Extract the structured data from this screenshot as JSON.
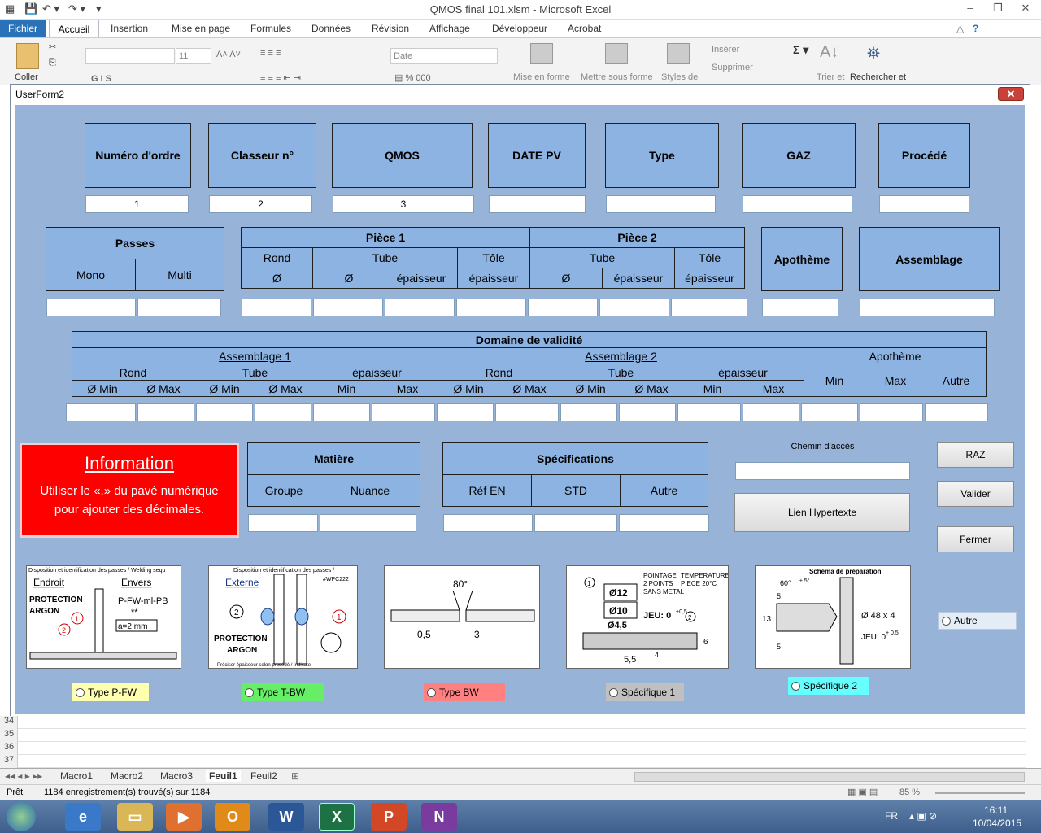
{
  "window": {
    "title": "QMOS final 101.xlsm  -  Microsoft Excel"
  },
  "ribbon": {
    "tabs": [
      "Fichier",
      "Accueil",
      "Insertion",
      "Mise en page",
      "Formules",
      "Données",
      "Révision",
      "Affichage",
      "Développeur",
      "Acrobat"
    ],
    "coller": "Coller",
    "font_size": "11",
    "number_format": "Date",
    "inserer": "Insérer",
    "supprimer": "Supprimer",
    "mise_en_forme": "Mise en forme",
    "mettre_sous_forme": "Mettre sous forme",
    "styles_de": "Styles de",
    "trier": "Trier et",
    "rechercher": "Rechercher et"
  },
  "form": {
    "title": "UserForm2",
    "close": "✕",
    "top_headers": [
      "Numéro d'ordre",
      "Classeur n°",
      "QMOS",
      "DATE PV",
      "Type",
      "GAZ",
      "Procédé"
    ],
    "top_values": [
      "1",
      "2",
      "3",
      "",
      "",
      "",
      ""
    ],
    "passes": {
      "title": "Passes",
      "mono": "Mono",
      "multi": "Multi"
    },
    "piece1": {
      "title": "Pièce 1",
      "rond": "Rond",
      "tube": "Tube",
      "tole": "Tôle",
      "phi": "Ø",
      "epaisseur": "épaisseur"
    },
    "piece2": {
      "title": "Pièce 2",
      "tube": "Tube",
      "tole": "Tôle",
      "phi": "Ø",
      "epaisseur": "épaisseur"
    },
    "apotheme": "Apothème",
    "assemblage": "Assemblage",
    "domaine": {
      "title": "Domaine de validité",
      "assemblage1": "Assemblage 1",
      "assemblage2": "Assemblage 2",
      "apotheme": "Apothème",
      "rond": "Rond",
      "tube": "Tube",
      "epaisseur": "épaisseur",
      "phi_min": "Ø Min",
      "phi_max": "Ø Max",
      "min": "Min",
      "max": "Max",
      "autre": "Autre"
    },
    "information": {
      "title": "Information",
      "text1": "Utiliser le «.» du pavé numérique",
      "text2": "pour ajouter des décimales."
    },
    "matiere": {
      "title": "Matière",
      "groupe": "Groupe",
      "nuance": "Nuance"
    },
    "specifications": {
      "title": "Spécifications",
      "ref_en": "Réf EN",
      "std": "STD",
      "autre": "Autre"
    },
    "chemin": "Chemin d'accès",
    "lien": "Lien Hypertexte",
    "buttons": {
      "raz": "RAZ",
      "valider": "Valider",
      "fermer": "Fermer"
    },
    "radios": [
      "Type P-FW",
      "Type T-BW",
      "Type BW",
      "Spécifique 1",
      "Spécifique 2",
      "Autre"
    ],
    "radio_colors": [
      "#ffffb0",
      "#66ee66",
      "#ff8080",
      "#c0c0c0",
      "#66ffff",
      "#ffffff"
    ],
    "pictures": {
      "p1": {
        "l1": "Disposition et identification des passes / Welding sequ",
        "endroit": "Endroit",
        "envers": "Envers",
        "protection": "PROTECTION",
        "argon": "ARGON",
        "code": "P-FW-ml-PB",
        "star": "**",
        "a": "a=2  mm",
        "n1": "1",
        "n2": "2"
      },
      "p2": {
        "l1": "Disposition et identification des passes / ",
        "externe": "Externe",
        "ref": "#WPC222",
        "protection": "PROTECTION",
        "argon": "ARGON",
        "foot": "Préciser épaisseur selon procédé / Indicate",
        "n1": "1",
        "n2": "2"
      },
      "p3": {
        "angle": "80°",
        "a": "0,5",
        "b": "3"
      },
      "p4": {
        "l1": "POINTAGE",
        "l2": "2 POINTS",
        "l3": "SANS METAL",
        "t1": "TEMPERATURE",
        "t2": "PIECE 20°C",
        "d1": "Ø12",
        "d2": "Ø10",
        "d3": "Ø4,5",
        "jeu": "JEU: 0",
        "tol": "+0,5",
        "n1": "1",
        "n2": "2",
        "w": "5,5",
        "h": "4",
        "v": "6"
      },
      "p5": {
        "title": "Schéma de préparation",
        "angle": "60°",
        "tol": "± 5°",
        "d": "Ø 48 x 4",
        "jeu": "JEU: 0",
        "tolj": "+ 0,5",
        "v1": "13",
        "v2": "5",
        "v3": "5"
      }
    }
  },
  "sheet": {
    "rows": [
      "34",
      "35",
      "36",
      "37"
    ],
    "tabs": [
      "Macro1",
      "Macro2",
      "Macro3",
      "Feuil1",
      "Feuil2"
    ],
    "status": "Prêt",
    "records": "1184 enregistrement(s) trouvé(s) sur 1184",
    "zoom": "85 %"
  },
  "taskbar": {
    "lang": "FR",
    "time": "16:11",
    "date": "10/04/2015"
  }
}
